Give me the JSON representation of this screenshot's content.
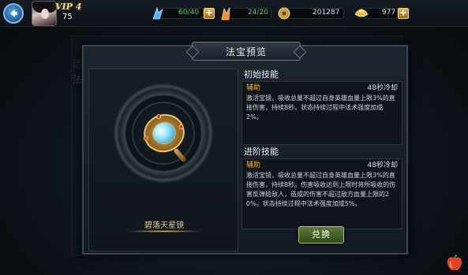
{
  "header": {
    "vip_label": "VIP 4",
    "level": "75",
    "stamina": {
      "icon": "blue-wing-icon",
      "label": "60/40"
    },
    "energy": {
      "icon": "orange-flame-icon",
      "label": "24/20"
    },
    "coins": {
      "icon": "coin-icon",
      "label": "201287"
    },
    "gold": {
      "icon": "gold-ingot-icon",
      "label": "977"
    }
  },
  "background": {
    "ghost_char_1": "活",
    "ghost_char_2": "法"
  },
  "dialog": {
    "title": "法宝预览",
    "treasure_name": "碧落天星镜",
    "initial_skill": {
      "heading": "初始技能",
      "type": "辅助",
      "cooldown": "48秒冷却",
      "description": "激活宝镜，吸收总量不超过自身英雄血量上限3%的直接伤害，持续8秒。状态持续过程中法术强度加成2%。"
    },
    "advanced_skill": {
      "heading": "进阶技能",
      "type": "辅助",
      "cooldown": "48秒冷却",
      "description": "激活宝镜，吸收总量不超过自身英雄血量上限3%的直接伤害，持续8秒。伤害吸收达到上限时将所吸收的伤害反弹给敌人，造成的伤害不超过敌方血量上限的20%。状态持续过程中法术强度加成5%。"
    },
    "exchange_label": "兑换"
  },
  "colors": {
    "accent_gold": "#e7b545",
    "stamina_green": "#5fd35f",
    "energy_green": "#5fd35f",
    "button_green": "#5f7a38"
  }
}
